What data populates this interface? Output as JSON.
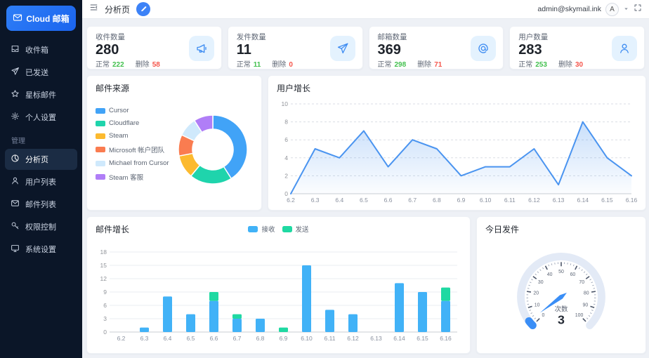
{
  "app": {
    "name": "Cloud 邮箱"
  },
  "sidebar": {
    "sections": [
      {
        "label": "",
        "items": [
          {
            "label": "收件箱",
            "icon": "inbox-icon"
          },
          {
            "label": "已发送",
            "icon": "send-icon"
          },
          {
            "label": "星标邮件",
            "icon": "star-icon"
          },
          {
            "label": "个人设置",
            "icon": "gear-icon"
          }
        ]
      },
      {
        "label": "管理",
        "items": [
          {
            "label": "分析页",
            "icon": "pie-chart-icon",
            "active": true
          },
          {
            "label": "用户列表",
            "icon": "user-icon"
          },
          {
            "label": "邮件列表",
            "icon": "mail-icon"
          },
          {
            "label": "权限控制",
            "icon": "key-icon"
          },
          {
            "label": "系统设置",
            "icon": "monitor-icon"
          }
        ]
      }
    ]
  },
  "header": {
    "title": "分析页",
    "user_email": "admin@skymail.ink",
    "avatar_initial": "A"
  },
  "stats": [
    {
      "label": "收件数量",
      "value": "280",
      "normal_label": "正常",
      "normal_value": "222",
      "deleted_label": "删除",
      "deleted_value": "58",
      "icon": "megaphone-icon"
    },
    {
      "label": "发件数量",
      "value": "11",
      "normal_label": "正常",
      "normal_value": "11",
      "deleted_label": "删除",
      "deleted_value": "0",
      "icon": "send-icon"
    },
    {
      "label": "邮箱数量",
      "value": "369",
      "normal_label": "正常",
      "normal_value": "298",
      "deleted_label": "删除",
      "deleted_value": "71",
      "icon": "at-icon"
    },
    {
      "label": "用户数量",
      "value": "283",
      "normal_label": "正常",
      "normal_value": "253",
      "deleted_label": "删除",
      "deleted_value": "30",
      "icon": "user-icon"
    }
  ],
  "colors": {
    "primary": "#2b7cf6",
    "success": "#43c04f",
    "danger": "#f5564c",
    "sidebar_bg": "#0b1628"
  },
  "chart_data": [
    {
      "type": "pie",
      "title": "邮件来源",
      "donut": true,
      "legend_position": "left",
      "series": [
        {
          "name": "Cursor",
          "value": 41,
          "color": "#41a3f7"
        },
        {
          "name": "Cloudflare",
          "value": 20,
          "color": "#1fd4ac"
        },
        {
          "name": "Steam",
          "value": 11,
          "color": "#fcba2f"
        },
        {
          "name": "Microsoft 帐户团队",
          "value": 10,
          "color": "#fa7c50"
        },
        {
          "name": "Michael from Cursor",
          "value": 9,
          "color": "#cfe9fc"
        },
        {
          "name": "Steam 客服",
          "value": 9,
          "color": "#b07ef7"
        }
      ]
    },
    {
      "type": "area",
      "title": "用户增长",
      "x": [
        "6.2",
        "6.3",
        "6.4",
        "6.5",
        "6.6",
        "6.7",
        "6.8",
        "6.9",
        "6.10",
        "6.11",
        "6.12",
        "6.13",
        "6.14",
        "6.15",
        "6.16"
      ],
      "values": [
        0,
        5,
        4,
        7,
        3,
        6,
        5,
        2,
        3,
        3,
        5,
        1,
        8,
        4,
        2
      ],
      "ylim": [
        0,
        10
      ],
      "yticks": [
        0,
        2,
        4,
        6,
        8,
        10
      ],
      "color": "#4a94f0",
      "grid": "dashed",
      "legend_position": "none"
    },
    {
      "type": "bar",
      "title": "邮件增长",
      "stacked": true,
      "legend_position": "top",
      "categories": [
        "6.2",
        "6.3",
        "6.4",
        "6.5",
        "6.6",
        "6.7",
        "6.8",
        "6.9",
        "6.10",
        "6.11",
        "6.12",
        "6.13",
        "6.14",
        "6.15",
        "6.16"
      ],
      "series": [
        {
          "name": "接收",
          "color": "#41b2f7",
          "values": [
            0,
            1,
            8,
            4,
            7,
            3,
            3,
            0,
            15,
            5,
            4,
            0,
            11,
            9,
            7
          ]
        },
        {
          "name": "发送",
          "color": "#1fd9a2",
          "values": [
            0,
            0,
            0,
            0,
            2,
            1,
            0,
            1,
            0,
            0,
            0,
            0,
            0,
            0,
            3
          ]
        }
      ],
      "ylim": [
        0,
        18
      ],
      "yticks": [
        0,
        3,
        6,
        9,
        12,
        15,
        18
      ]
    },
    {
      "type": "gauge",
      "title": "今日发件",
      "min": 0,
      "max": 100,
      "value": 3,
      "label": "次数",
      "major_tick": 10,
      "minor_tick": 2,
      "color": "#3a8ef6",
      "track_color": "#e3eaf6"
    }
  ]
}
